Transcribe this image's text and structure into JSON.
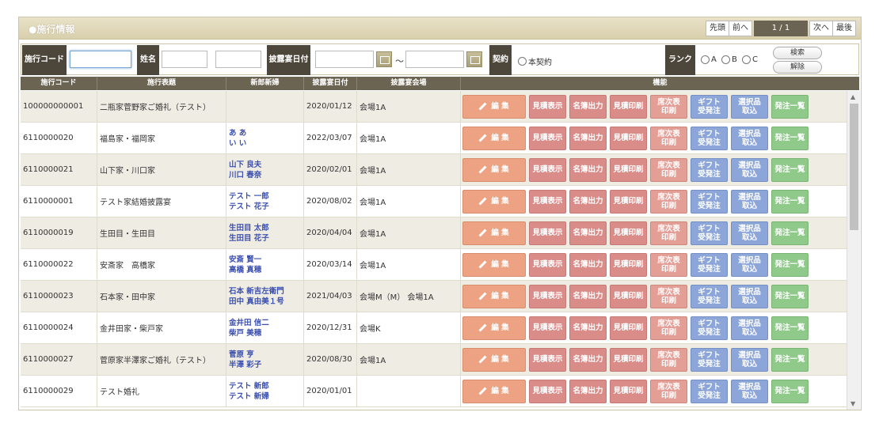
{
  "header": {
    "title": "●施行情報"
  },
  "pager": {
    "first": "先頭",
    "prev": "前へ",
    "page": "1 / 1",
    "next": "次へ",
    "last": "最後"
  },
  "search": {
    "code_label": "施行コード",
    "name_label": "姓名",
    "date_label": "披露宴日付",
    "tilde": "～",
    "contract_label": "契約",
    "contract_option": "本契約",
    "rank_label": "ランク",
    "rank_options": [
      "A",
      "B",
      "C"
    ],
    "search_button": "検索",
    "clear_button": "解除"
  },
  "table": {
    "headers": [
      "施行コード",
      "施行表題",
      "新郎新婦",
      "披露宴日付",
      "披露宴会場",
      "機能"
    ],
    "buttons": {
      "edit": "編 集",
      "estimate_view": "見積表示",
      "namebook": "名簿出力",
      "estimate_print": "見積印刷",
      "seat_print_1": "席次表",
      "seat_print_2": "印刷",
      "gift_1": "ギフト",
      "gift_2": "受発注",
      "select_1": "選択品",
      "select_2": "取込",
      "order_list": "発注一覧"
    },
    "rows": [
      {
        "code": "100000000001",
        "title": "二瓶家菅野家ご婚礼（テスト）",
        "groom": "",
        "bride": "",
        "date": "2020/01/12",
        "venue": "会場1A"
      },
      {
        "code": "6110000020",
        "title": "福島家・福岡家",
        "groom": "あ あ",
        "bride": "い い",
        "date": "2022/03/07",
        "venue": "会場1A"
      },
      {
        "code": "6110000021",
        "title": "山下家・川口家",
        "groom": "山下 良夫",
        "bride": "川口 春奈",
        "date": "2020/02/01",
        "venue": "会場1A"
      },
      {
        "code": "6110000001",
        "title": "テスト家結婚披露宴",
        "groom": "テスト 一郎",
        "bride": "テスト 花子",
        "date": "2020/08/02",
        "venue": "会場1A"
      },
      {
        "code": "6110000019",
        "title": "生田目・生田目",
        "groom": "生田目 太郎",
        "bride": "生田目 花子",
        "date": "2020/04/04",
        "venue": "会場1A"
      },
      {
        "code": "6110000022",
        "title": "安斎家　高橋家",
        "groom": "安斎 賢一",
        "bride": "高橋 真穂",
        "date": "2020/03/14",
        "venue": "会場1A"
      },
      {
        "code": "6110000023",
        "title": "石本家・田中家",
        "groom": "石本 新吉左衛門",
        "bride": "田中 真由美１号",
        "date": "2021/04/03",
        "venue": "会場M（M） 会場1A"
      },
      {
        "code": "6110000024",
        "title": "金井田家・柴戸家",
        "groom": "金井田 信二",
        "bride": "柴戸 美穂",
        "date": "2020/12/31",
        "venue": "会場K"
      },
      {
        "code": "6110000027",
        "title": "菅原家半澤家ご婚礼（テスト）",
        "groom": "菅原 亨",
        "bride": "半澤 彩子",
        "date": "2020/08/30",
        "venue": "会場1A"
      },
      {
        "code": "6110000029",
        "title": "テスト婚礼",
        "groom": "テスト 新郎",
        "bride": "テスト 新婦",
        "date": "2020/01/01",
        "venue": ""
      }
    ]
  }
}
